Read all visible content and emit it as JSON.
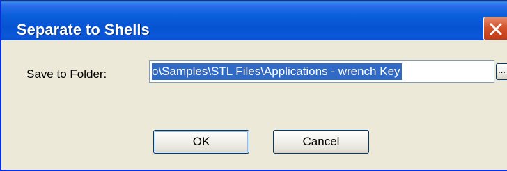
{
  "dialog": {
    "title": "Separate to Shells",
    "folder_label": "Save to Folder:",
    "folder_path": "o\\Samples\\STL Files\\Applications - wrench Key",
    "browse_label": "...",
    "ok_label": "OK",
    "cancel_label": "Cancel"
  },
  "colors": {
    "titlebar": "#0A58D8",
    "dialog_bg": "#ECE9D8",
    "selection": "#316AC5",
    "close_button": "#D3542C"
  },
  "icons": {
    "close": "close-x-icon"
  }
}
